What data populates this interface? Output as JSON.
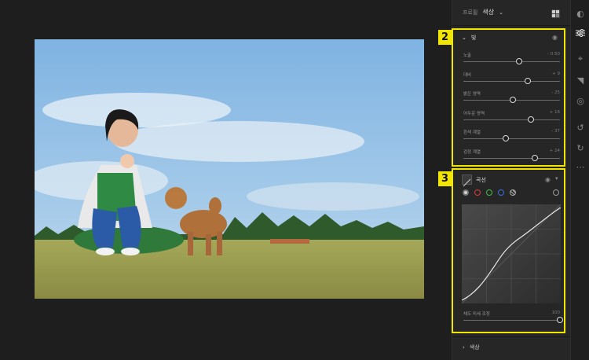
{
  "panel": {
    "profile_label": "프로필",
    "profile_value": "색상",
    "light_section": {
      "title": "빛",
      "badge": "2",
      "sliders": [
        {
          "label": "노출",
          "value": "- 0.50",
          "pos": 0.58
        },
        {
          "label": "대비",
          "value": "+ 9",
          "pos": 0.67
        },
        {
          "label": "밝은 영역",
          "value": "- 25",
          "pos": 0.51
        },
        {
          "label": "어두운 영역",
          "value": "+ 16",
          "pos": 0.7
        },
        {
          "label": "흰색 계열",
          "value": "- 37",
          "pos": 0.44
        },
        {
          "label": "검정 계열",
          "value": "+ 24",
          "pos": 0.74
        }
      ]
    },
    "curve_section": {
      "title": "곡선",
      "badge": "3",
      "refine_label": "채도 미세 조정",
      "refine_value": "100",
      "refine_pos": 1.0
    },
    "color_section": {
      "title": "색상"
    }
  },
  "colors": {
    "highlight": "#f2e600",
    "channel_red": "#d83a3a",
    "channel_green": "#3fbf3f",
    "channel_blue": "#3a6fe0"
  }
}
